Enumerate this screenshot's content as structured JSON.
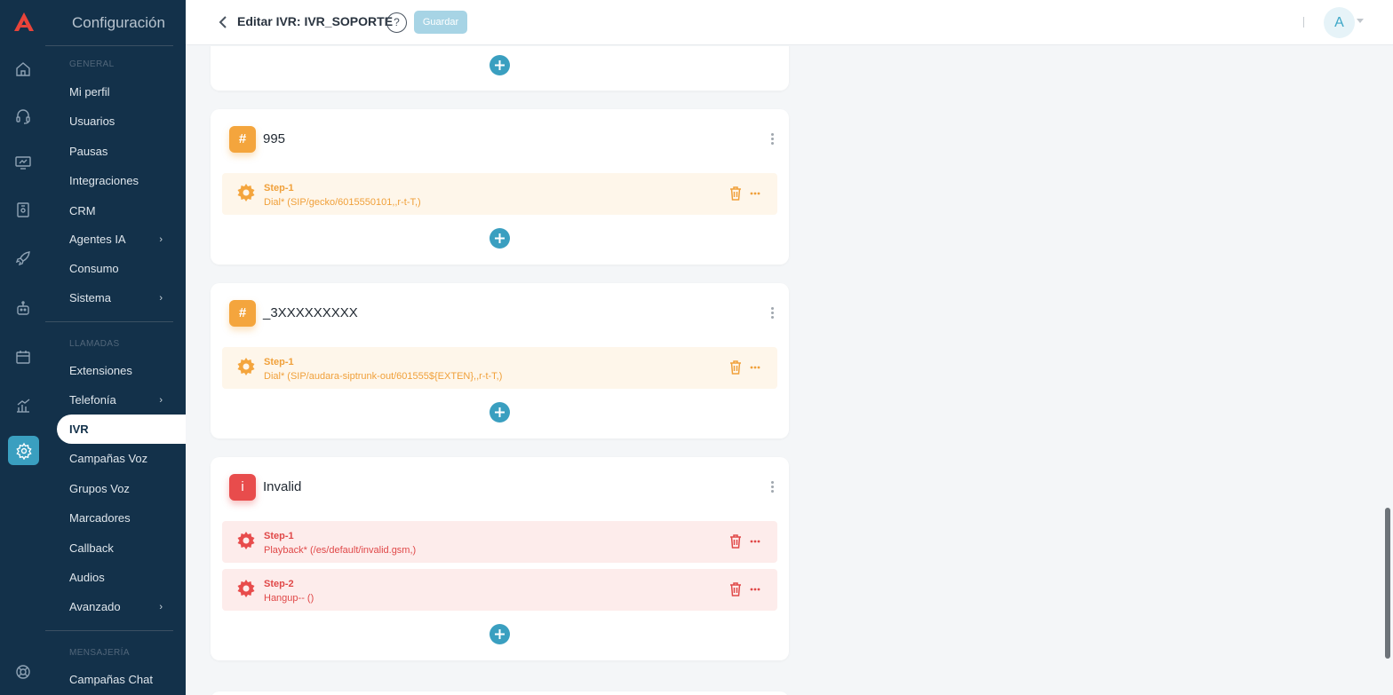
{
  "menu": {
    "title": "Configuración",
    "sections": {
      "general": "GENERAL",
      "llamadas": "LLAMADAS",
      "mensajeria": "MENSAJERÍA"
    },
    "items": {
      "mi_perfil": "Mi perfil",
      "usuarios": "Usuarios",
      "pausas": "Pausas",
      "integraciones": "Integraciones",
      "crm": "CRM",
      "agentes_ia": "Agentes IA",
      "consumo": "Consumo",
      "sistema": "Sistema",
      "extensiones": "Extensiones",
      "telefonia": "Telefonía",
      "ivr": "IVR",
      "campanas_voz": "Campañas Voz",
      "grupos_voz": "Grupos Voz",
      "marcadores": "Marcadores",
      "callback": "Callback",
      "audios": "Audios",
      "avanzado": "Avanzado",
      "campanas_chat": "Campañas Chat"
    },
    "active": "IVR"
  },
  "header": {
    "title": "Editar IVR: IVR_SOPORTE",
    "help": "?",
    "save_label": "Guardar",
    "avatar_initial": "A"
  },
  "cards": [
    {
      "badge": "#",
      "title": "995",
      "color": "orange",
      "steps": [
        {
          "name": "Step-1",
          "desc": "Dial* (SIP/gecko/6015550101,,r-t-T,)"
        }
      ]
    },
    {
      "badge": "#",
      "title": "_3XXXXXXXXX",
      "color": "orange",
      "steps": [
        {
          "name": "Step-1",
          "desc": "Dial* (SIP/audara-siptrunk-out/601555${EXTEN},,r-t-T,)"
        }
      ]
    },
    {
      "badge": "i",
      "title": "Invalid",
      "color": "red",
      "steps": [
        {
          "name": "Step-1",
          "desc": "Playback* (/es/default/invalid.gsm,)"
        },
        {
          "name": "Step-2",
          "desc": "Hangup-- ()"
        }
      ]
    }
  ],
  "colors": {
    "sidebar": "#13314a",
    "accent": "#3a9fc0",
    "orange": "#f4a53d",
    "red": "#e84c4c"
  }
}
